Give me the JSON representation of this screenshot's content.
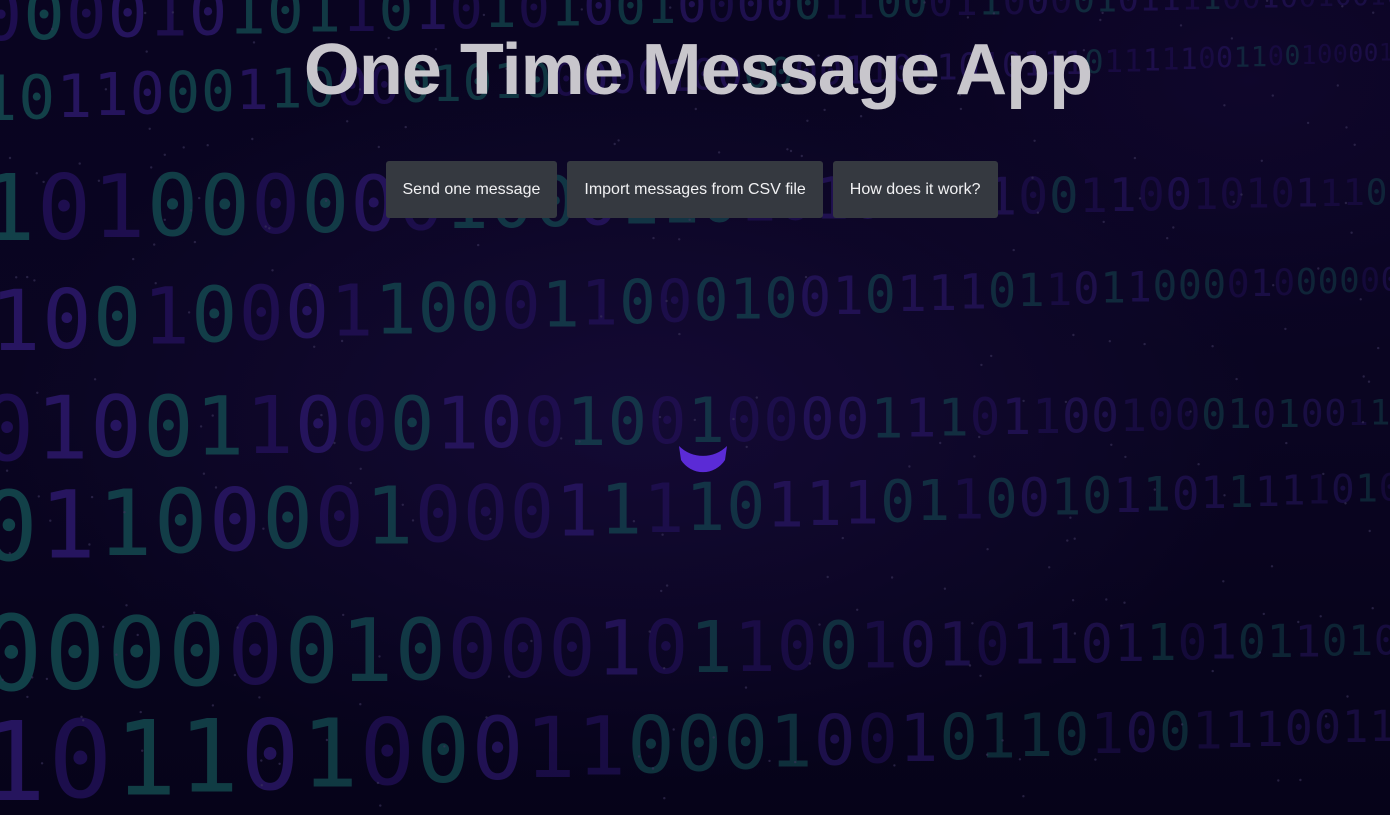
{
  "app": {
    "title": "One Time Message App"
  },
  "nav": {
    "buttons": [
      {
        "label": "Send one message"
      },
      {
        "label": "Import messages from CSV file"
      },
      {
        "label": "How does it work?"
      }
    ]
  },
  "loading": {
    "indicator": "spinner-icon",
    "color": "#5b2bd6"
  },
  "background": {
    "pattern": "binary-digits",
    "colors": [
      "#1f8a7e",
      "#3a1c8c",
      "#4d2bb0"
    ]
  }
}
